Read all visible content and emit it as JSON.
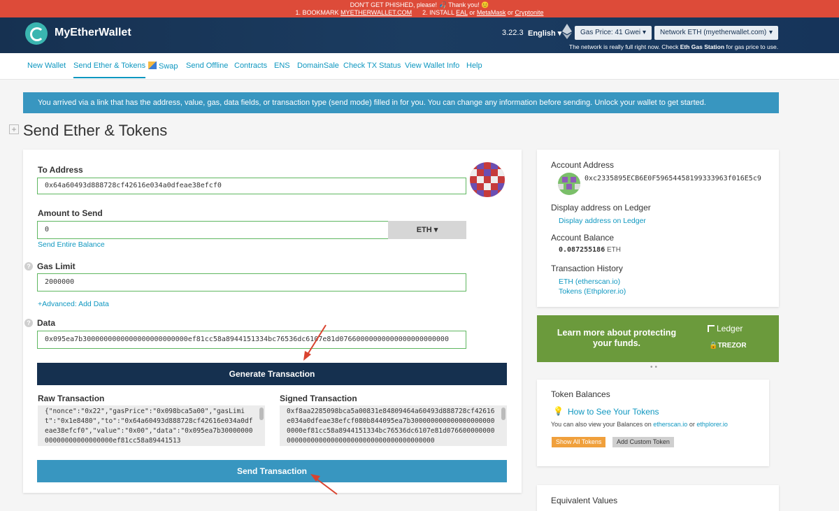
{
  "banner": {
    "line1_prefix": "DON'T GET PHISHED, please!",
    "line1_suffix": "Thank you!",
    "bookmark_prefix": "1. BOOKMARK",
    "bookmark_link": "MYETHERWALLET.COM",
    "install_prefix": "2. INSTALL",
    "install_eal": "EAL",
    "or1": "or",
    "install_metamask": "MetaMask",
    "or2": "or",
    "install_cryptonite": "Cryptonite"
  },
  "header": {
    "app_name": "MyEtherWallet",
    "version": "3.22.3",
    "language": "English",
    "gas_price": "Gas Price: 41 Gwei",
    "network": "Network ETH (myetherwallet.com)",
    "note_prefix": "The network is really full right now. Check",
    "note_link": "Eth Gas Station",
    "note_suffix": "for gas price to use."
  },
  "nav": {
    "items": [
      "New Wallet",
      "Send Ether & Tokens",
      "Swap",
      "Send Offline",
      "Contracts",
      "ENS",
      "DomainSale",
      "Check TX Status",
      "View Wallet Info",
      "Help"
    ],
    "active_index": 1
  },
  "alert": {
    "text": "You arrived via a link that has the address, value, gas, data fields, or transaction type (send mode) filled in for you. You can change any information before sending. Unlock your wallet to get started."
  },
  "page": {
    "title": "Send Ether & Tokens"
  },
  "form": {
    "to_label": "To Address",
    "to_value": "0x64a60493d888728cf42616e034a0dfeae38efcf0",
    "amount_label": "Amount to Send",
    "amount_value": "0",
    "currency": "ETH",
    "send_entire": "Send Entire Balance",
    "gas_label": "Gas Limit",
    "gas_value": "2000000",
    "advanced": "+Advanced: Add Data",
    "data_label": "Data",
    "data_value": "0x095ea7b3000000000000000000000000ef81cc58a8944151334bc76536dc6107e81d07660000000000000000000000",
    "generate_btn": "Generate Transaction",
    "raw_label": "Raw Transaction",
    "raw_value": "{\"nonce\":\"0x22\",\"gasPrice\":\"0x098bca5a00\",\"gasLimit\":\"0x1e8480\",\"to\":\"0x64a60493d888728cf42616e034a0dfeae38efcf0\",\"value\":\"0x00\",\"data\":\"0x095ea7b3000000000000000000000000ef81cc58a89441513",
    "signed_label": "Signed Transaction",
    "signed_value": "0xf8aa2285098bca5a00831e84809464a60493d888728cf42616e034a0dfeae38efcf080b844095ea7b3000000000000000000000000ef81cc58a8944151334bc76536dc6107e81d0766000000000000000000000000000000000000000000000",
    "send_btn": "Send Transaction"
  },
  "account": {
    "address_label": "Account Address",
    "address_value": "0xc2335895ECB6E0F59654458199333963f016E5c9",
    "ledger_label": "Display address on Ledger",
    "ledger_link": "Display address on Ledger",
    "balance_label": "Account Balance",
    "balance_value": "0.087255186",
    "balance_unit": "ETH",
    "history_label": "Transaction History",
    "history_eth": "ETH (etherscan.io)",
    "history_tokens": "Tokens (Ethplorer.io)"
  },
  "promo": {
    "text": "Learn more about protecting your funds.",
    "ledger_brand": "Ledger",
    "trezor_brand": "TREZOR"
  },
  "tokens": {
    "title": "Token Balances",
    "how_to": "How to See Your Tokens",
    "also_prefix": "You can also view your Balances on",
    "etherscan": "etherscan.io",
    "or": "or",
    "ethplorer": "ethplorer.io",
    "show_all_btn": "Show All Tokens",
    "add_custom_btn": "Add Custom Token"
  },
  "equivalent": {
    "title": "Equivalent Values"
  },
  "colors": {
    "banner": "#dd4b39",
    "header": "#163151",
    "accent": "#0e97c0",
    "alert": "#3896c0",
    "dark_button": "#15304f",
    "valid_border": "#5fb760",
    "promo_green": "#6b9a3c",
    "orange_btn": "#f0a03c"
  }
}
